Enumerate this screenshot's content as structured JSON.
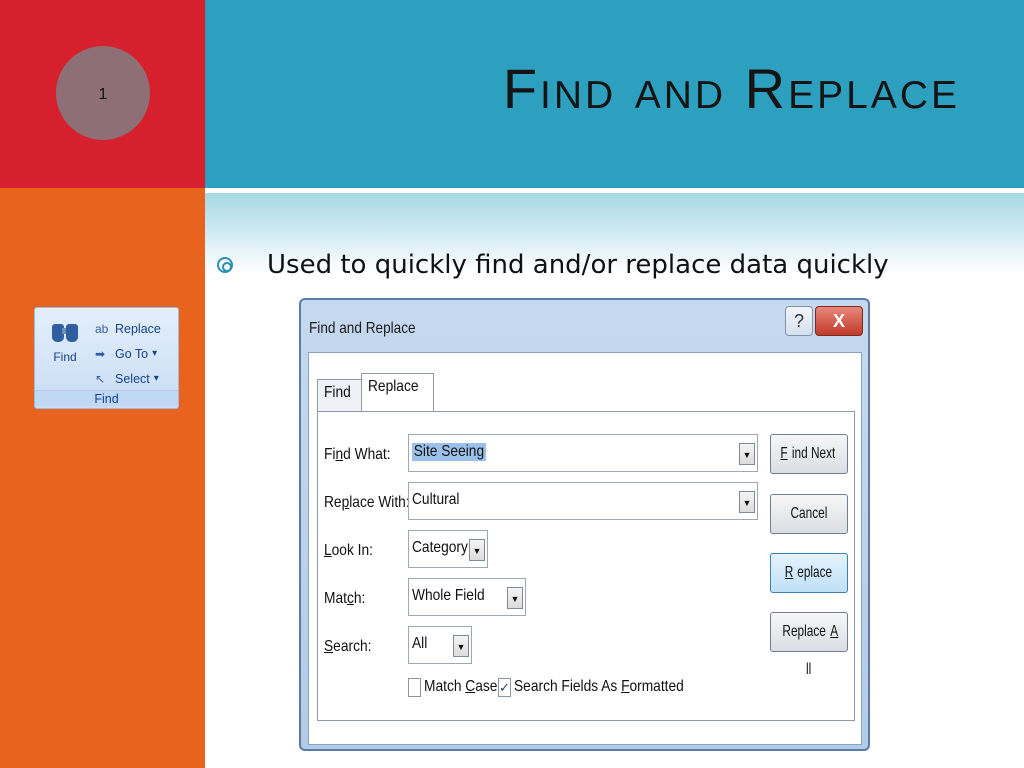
{
  "slide": {
    "number": "1",
    "title": "Find and Replace",
    "bullet": "Used to quickly find and/or replace data quickly"
  },
  "ribbon": {
    "find_label": "Find",
    "items": [
      "Replace",
      "Go To",
      "Select"
    ],
    "dropdown_glyph": "▾",
    "group_caption": "Find"
  },
  "dialog": {
    "title": "Find and Replace",
    "help_glyph": "?",
    "close_glyph": "X",
    "tabs": [
      "Find",
      "Replace"
    ],
    "active_tab": "Replace",
    "fields": {
      "find_what": {
        "label_pre": "Fi",
        "label_ul": "n",
        "label_post": "d What:",
        "value": "Site Seeing"
      },
      "replace_with": {
        "label_pre": "Re",
        "label_ul": "p",
        "label_post": "lace With:",
        "value": "Cultural"
      },
      "look_in": {
        "label_pre": "",
        "label_ul": "L",
        "label_post": "ook In:",
        "value": "Category"
      },
      "match": {
        "label_pre": "Mat",
        "label_ul": "c",
        "label_post": "h:",
        "value": "Whole Field"
      },
      "search": {
        "label_pre": "",
        "label_ul": "S",
        "label_post": "earch:",
        "value": "All"
      }
    },
    "dropdown_glyph": "▼",
    "buttons": {
      "find_next": {
        "pre": "",
        "ul": "F",
        "post": "ind Next"
      },
      "cancel": {
        "pre": "",
        "ul": "",
        "post": "Cancel"
      },
      "replace": {
        "pre": "",
        "ul": "R",
        "post": "eplace"
      },
      "replace_all": {
        "pre": "Replace ",
        "ul": "A",
        "post": "ll"
      }
    },
    "checkboxes": {
      "match_case": {
        "label_pre": "Match ",
        "label_ul": "C",
        "label_post": "ase",
        "checked": false
      },
      "search_formatted": {
        "label_pre": "Search Fields As ",
        "label_ul": "F",
        "label_post": "ormatted",
        "checked": true,
        "mark": "✓"
      }
    }
  },
  "colors": {
    "title_band": "#2da0c0",
    "left_top": "#d7202e",
    "left_bottom": "#e8631e",
    "slide_number_circle": "#8e6f76"
  }
}
